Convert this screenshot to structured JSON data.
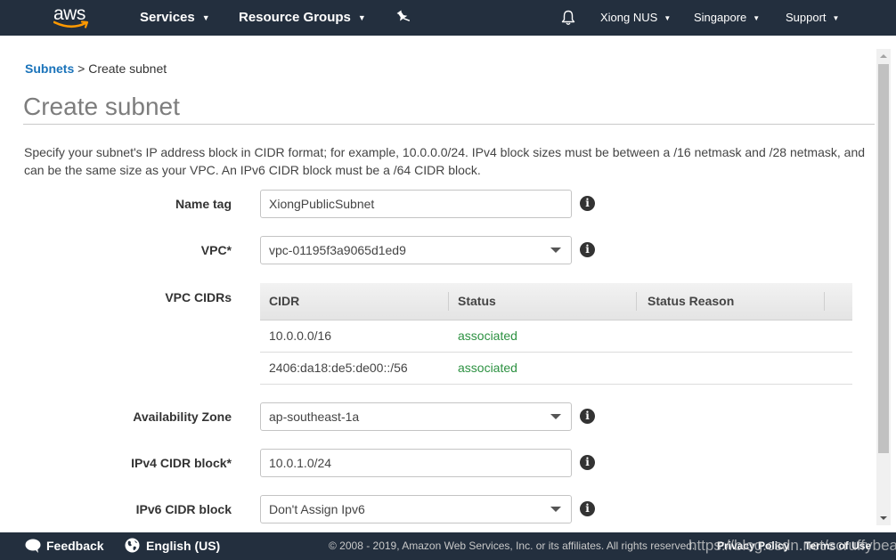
{
  "topnav": {
    "logo_text": "aws",
    "services_label": "Services",
    "resource_groups_label": "Resource Groups",
    "account_label": "Xiong NUS",
    "region_label": "Singapore",
    "support_label": "Support"
  },
  "breadcrumb": {
    "parent": "Subnets",
    "separator": ">",
    "current": "Create subnet"
  },
  "page": {
    "title": "Create subnet",
    "description": "Specify your subnet's IP address block in CIDR format; for example, 10.0.0.0/24. IPv4 block sizes must be between a /16 netmask and /28 netmask, and can be the same size as your VPC. An IPv6 CIDR block must be a /64 CIDR block."
  },
  "form": {
    "name_tag": {
      "label": "Name tag",
      "value": "XiongPublicSubnet"
    },
    "vpc": {
      "label": "VPC*",
      "value": "vpc-01195f3a9065d1ed9"
    },
    "vpc_cidrs": {
      "label": "VPC CIDRs",
      "columns": [
        "CIDR",
        "Status",
        "Status Reason"
      ],
      "rows": [
        {
          "cidr": "10.0.0.0/16",
          "status": "associated",
          "reason": ""
        },
        {
          "cidr": "2406:da18:de5:de00::/56",
          "status": "associated",
          "reason": ""
        }
      ]
    },
    "availability_zone": {
      "label": "Availability Zone",
      "value": "ap-southeast-1a"
    },
    "ipv4_cidr": {
      "label": "IPv4 CIDR block*",
      "value": "10.0.1.0/24"
    },
    "ipv6_cidr": {
      "label": "IPv6 CIDR block",
      "value": "Don't Assign Ipv6"
    }
  },
  "footer": {
    "feedback_label": "Feedback",
    "language_label": "English (US)",
    "copyright": "© 2008 - 2019, Amazon Web Services, Inc. or its affiliates. All rights reserved.",
    "privacy_label": "Privacy Policy",
    "terms_label": "Terms of Use",
    "watermark": "https://blog.csdn.net/scruffybear"
  },
  "colors": {
    "nav_bg": "#232f3e",
    "link": "#1a73ba",
    "status_ok": "#2c9141",
    "aws_orange": "#ff9900"
  }
}
